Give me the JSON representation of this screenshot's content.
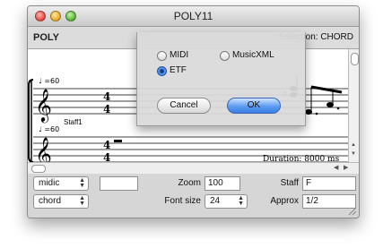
{
  "window": {
    "title": "POLY11"
  },
  "header": {
    "editor_name": "POLY",
    "selection_label": "Selection: CHORD"
  },
  "score": {
    "tempo_marks": [
      "♩ =60",
      "♩ =60"
    ],
    "staff_label": "Staff1",
    "duration_text": "Duration: 8000 ms",
    "time_signature": "4/4"
  },
  "dialog": {
    "options": [
      {
        "label": "MIDI",
        "selected": false
      },
      {
        "label": "MusicXML",
        "selected": false
      },
      {
        "label": "ETF",
        "selected": true
      }
    ],
    "cancel_label": "Cancel",
    "ok_label": "OK"
  },
  "controls": {
    "mode_popup": "midic",
    "type_popup": "chord",
    "blank_field": "",
    "zoom_label": "Zoom",
    "zoom_value": "100",
    "font_size_label": "Font size",
    "font_size_value": "24",
    "staff_label": "Staff",
    "staff_value": "F",
    "approx_label": "Approx",
    "approx_value": "1/2"
  },
  "icons": [
    "close-icon",
    "minimize-icon",
    "zoom-icon",
    "treble-clef-icon",
    "scroll-arrow-icon",
    "stepper-icon",
    "resize-grip-icon"
  ]
}
